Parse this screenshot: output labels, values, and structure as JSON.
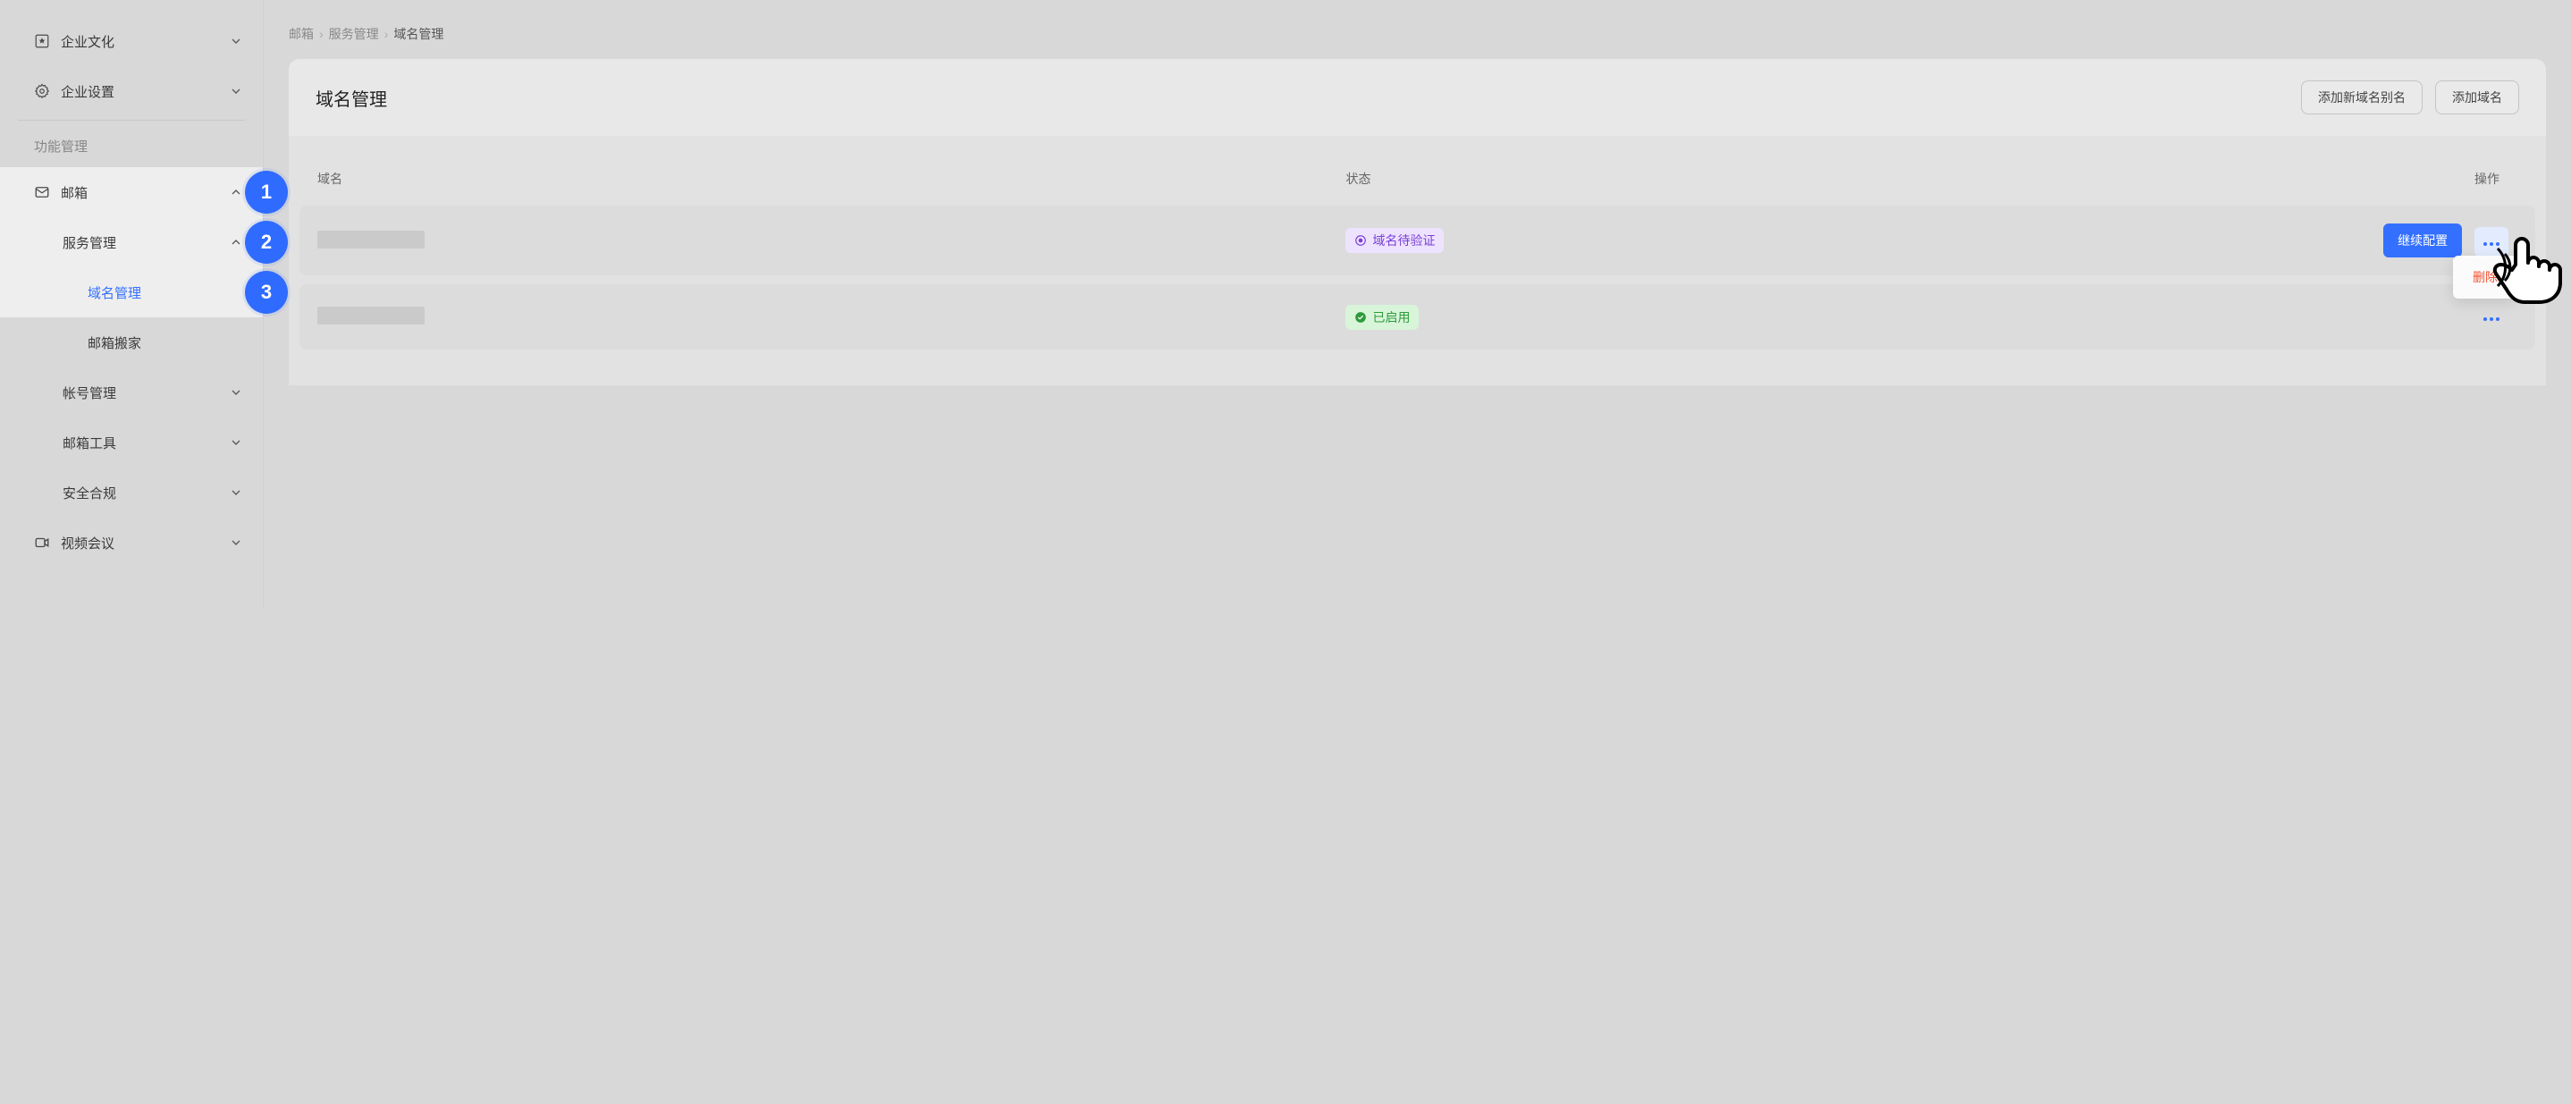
{
  "sidebar": {
    "items": [
      {
        "label": "企业文化"
      },
      {
        "label": "企业设置"
      }
    ],
    "section_head": "功能管理",
    "mail": {
      "label": "邮箱",
      "service_mgmt": "服务管理",
      "domain_mgmt": "域名管理",
      "mail_move": "邮箱搬家",
      "account_mgmt": "帐号管理",
      "mail_tools": "邮箱工具",
      "security": "安全合规"
    },
    "video": {
      "label": "视频会议"
    }
  },
  "steps": {
    "one": "1",
    "two": "2",
    "three": "3"
  },
  "breadcrumb": {
    "a": "邮箱",
    "b": "服务管理",
    "c": "域名管理"
  },
  "panel": {
    "title": "域名管理",
    "add_alias": "添加新域名别名",
    "add_domain": "添加域名"
  },
  "table": {
    "cols": {
      "domain": "域名",
      "status": "状态",
      "ops": "操作"
    },
    "rows": [
      {
        "status_label": "域名待验证",
        "status_kind": "pending",
        "action_primary": "继续配置"
      },
      {
        "status_label": "已启用",
        "status_kind": "enabled",
        "action_primary": null
      }
    ],
    "menu": {
      "delete": "删除"
    }
  }
}
